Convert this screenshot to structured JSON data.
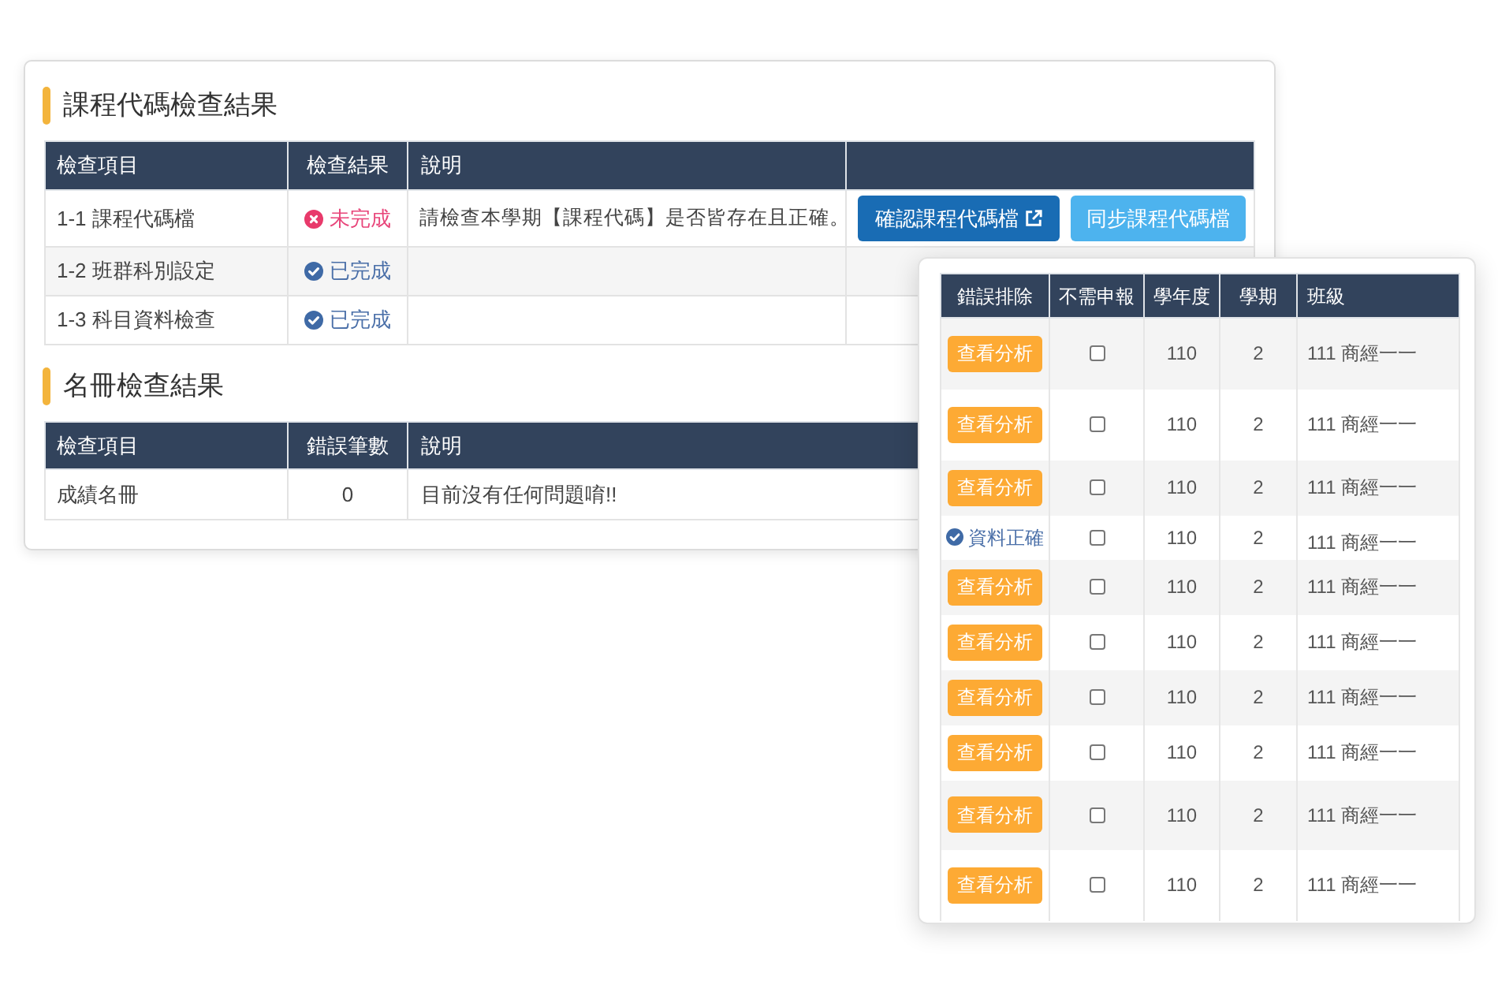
{
  "course_code_check": {
    "title": "課程代碼檢查結果",
    "columns": [
      "檢查項目",
      "檢查結果",
      "說明"
    ],
    "rows": [
      {
        "item": "1-1 課程代碼檔",
        "result": {
          "label": "未完成",
          "completed": false
        },
        "description": "請檢查本學期【課程代碼】是否皆存在且正確。",
        "actions": [
          {
            "label": "確認課程代碼檔",
            "kind": "open"
          },
          {
            "label": "同步課程代碼檔",
            "kind": "sync"
          }
        ]
      },
      {
        "item": "1-2 班群科別設定",
        "result": {
          "label": "已完成",
          "completed": true
        }
      },
      {
        "item": "1-3 科目資料檢查",
        "result": {
          "label": "已完成",
          "completed": true
        }
      }
    ]
  },
  "roster_check": {
    "title": "名冊檢查結果",
    "columns": [
      "檢查項目",
      "錯誤筆數",
      "說明"
    ],
    "rows": [
      {
        "item": "成績名冊",
        "error_count": "0",
        "description": "目前沒有任何問題唷!!"
      }
    ]
  },
  "error_popup": {
    "columns": [
      "錯誤排除",
      "不需申報",
      "學年度",
      "學期",
      "班級"
    ],
    "rows": [
      {
        "kind": "button",
        "action": "查看分析",
        "no_report": false,
        "year": "110",
        "semester": "2",
        "class": "111 商經一一"
      },
      {
        "kind": "button",
        "action": "查看分析",
        "no_report": false,
        "year": "110",
        "semester": "2",
        "class": "111 商經一一"
      },
      {
        "kind": "button",
        "action": "查看分析",
        "no_report": false,
        "year": "110",
        "semester": "2",
        "class": "111 商經一一"
      },
      {
        "kind": "status",
        "action": "資料正確",
        "no_report": false,
        "year": "110",
        "semester": "2",
        "class": "111 商經一一"
      },
      {
        "kind": "button",
        "action": "查看分析",
        "no_report": false,
        "year": "110",
        "semester": "2",
        "class": "111 商經一一"
      },
      {
        "kind": "button",
        "action": "查看分析",
        "no_report": false,
        "year": "110",
        "semester": "2",
        "class": "111 商經一一"
      },
      {
        "kind": "button",
        "action": "查看分析",
        "no_report": false,
        "year": "110",
        "semester": "2",
        "class": "111 商經一一"
      },
      {
        "kind": "button",
        "action": "查看分析",
        "no_report": false,
        "year": "110",
        "semester": "2",
        "class": "111 商經一一"
      },
      {
        "kind": "button",
        "action": "查看分析",
        "no_report": false,
        "year": "110",
        "semester": "2",
        "class": "111 商經一一"
      },
      {
        "kind": "button",
        "action": "查看分析",
        "no_report": false,
        "year": "110",
        "semester": "2",
        "class": "111 商經一一"
      }
    ]
  }
}
